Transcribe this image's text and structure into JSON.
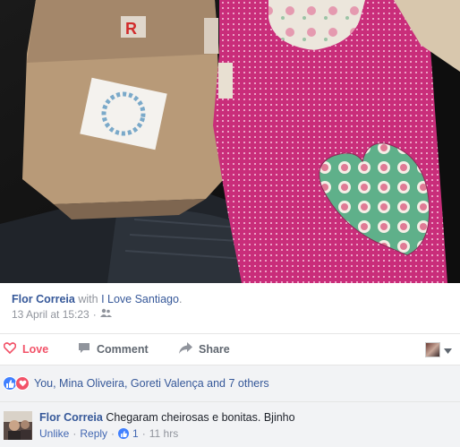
{
  "post": {
    "author": "Flor Correia",
    "with_text": "with",
    "page": "I Love Santiago",
    "period": ".",
    "timestamp": "13 April at 15:23",
    "separator": "·",
    "photo_icon": "package-on-car-seat",
    "privacy_icon": "friends-icon"
  },
  "actions": {
    "love_label": "Love",
    "comment_label": "Comment",
    "share_label": "Share"
  },
  "reactions": {
    "summary": "You, Mina Oliveira, Goreti Valença and 7 others"
  },
  "comment": {
    "author": "Flor Correia",
    "text": "Chegaram cheirosas e bonitas. Bjinho",
    "unlike_label": "Unlike",
    "reply_label": "Reply",
    "dot": "·",
    "like_count": "1",
    "time": "11 hrs"
  },
  "colors": {
    "link": "#365899",
    "love": "#f25268",
    "like": "#4080ff",
    "muted": "#90949c",
    "pink_fabric": "#d6337f"
  }
}
